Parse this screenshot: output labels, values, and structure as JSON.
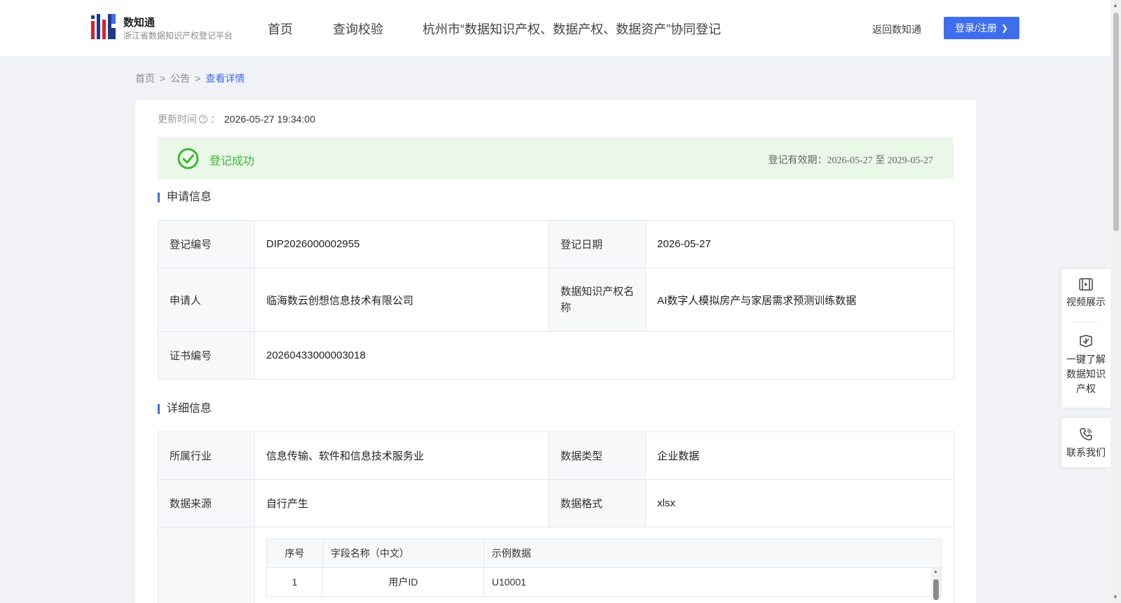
{
  "header": {
    "logo_title": "数知通",
    "logo_subtitle": "浙江省数据知识产权登记平台",
    "nav": [
      "首页",
      "查询校验",
      "杭州市“数据知识产权、数据产权、数据资产”协同登记"
    ],
    "back_link": "返回数知通",
    "login_label": "登录/注册",
    "accent_color": "#3f6df0"
  },
  "breadcrumb": {
    "items": [
      "首页",
      "公告"
    ],
    "current": "查看详情",
    "separator": ">"
  },
  "update": {
    "label": "更新时间",
    "colon": "：",
    "value": "2026-05-27 19:34:00"
  },
  "status": {
    "text": "登记成功",
    "valid_label": "登记有效期：",
    "valid_range": "2026-05-27 至 2029-05-27",
    "color": "#3eb734"
  },
  "application": {
    "title": "申请信息",
    "reg_no_label": "登记编号",
    "reg_no": "DIP2026000002955",
    "reg_date_label": "登记日期",
    "reg_date": "2026-05-27",
    "applicant_label": "申请人",
    "applicant": "临海数云创想信息技术有限公司",
    "ip_name_label_line1": "数据知识产权名",
    "ip_name_label_line2": "称",
    "ip_name": "AI数字人模拟房产与家居需求预测训练数据",
    "cert_no_label": "证书编号",
    "cert_no": "20260433000003018"
  },
  "detail": {
    "title": "详细信息",
    "industry_label": "所属行业",
    "industry": "信息传输、软件和信息技术服务业",
    "data_type_label": "数据类型",
    "data_type": "企业数据",
    "source_label": "数据来源",
    "source": "自行产生",
    "format_label": "数据格式",
    "format": "xlsx",
    "fields_table": {
      "headers": [
        "序号",
        "字段名称（中文）",
        "示例数据"
      ],
      "rows": [
        [
          "1",
          "用户ID",
          "U10001"
        ]
      ]
    }
  },
  "float_panel": {
    "video": "视频展示",
    "learn_line1": "一键了解",
    "learn_line2": "数据知识",
    "learn_line3": "产权",
    "contact": "联系我们"
  }
}
